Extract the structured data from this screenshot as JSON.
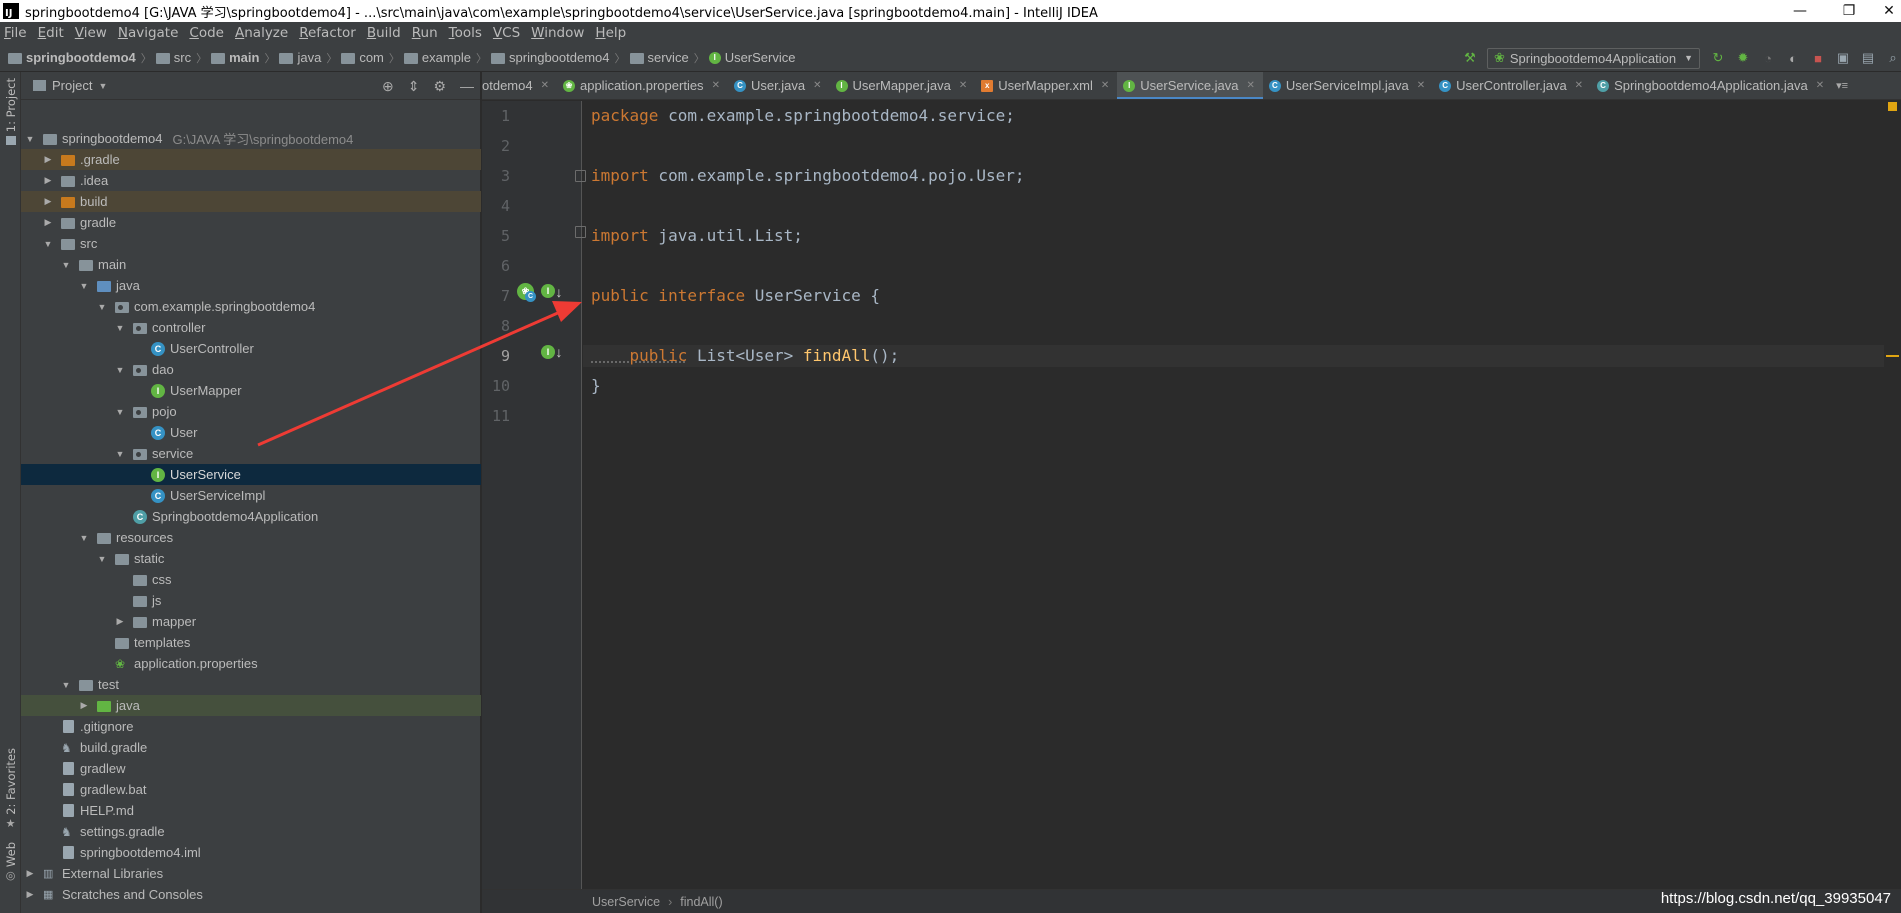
{
  "window": {
    "title": "springbootdemo4 [G:\\JAVA 学习\\springbootdemo4] - ...\\src\\main\\java\\com\\example\\springbootdemo4\\service\\UserService.java [springbootdemo4.main] - IntelliJ IDEA",
    "minimize": "—",
    "restore": "❐",
    "close": "✕"
  },
  "menu": [
    "File",
    "Edit",
    "View",
    "Navigate",
    "Code",
    "Analyze",
    "Refactor",
    "Build",
    "Run",
    "Tools",
    "VCS",
    "Window",
    "Help"
  ],
  "navbar": {
    "crumbs": [
      "springbootdemo4",
      "src",
      "main",
      "java",
      "com",
      "example",
      "springbootdemo4",
      "service",
      "UserService"
    ],
    "run_config": "Springbootdemo4Application"
  },
  "side_tabs": {
    "project": "1: Project",
    "favorites": "2: Favorites",
    "web": "Web"
  },
  "project_panel": {
    "title": "Project",
    "tree": [
      {
        "label": "springbootdemo4",
        "hint": "G:\\JAVA 学习\\springbootdemo4"
      },
      {
        "label": ".gradle"
      },
      {
        "label": ".idea"
      },
      {
        "label": "build"
      },
      {
        "label": "gradle"
      },
      {
        "label": "src"
      },
      {
        "label": "main"
      },
      {
        "label": "java"
      },
      {
        "label": "com.example.springbootdemo4"
      },
      {
        "label": "controller"
      },
      {
        "label": "UserController"
      },
      {
        "label": "dao"
      },
      {
        "label": "UserMapper"
      },
      {
        "label": "pojo"
      },
      {
        "label": "User"
      },
      {
        "label": "service"
      },
      {
        "label": "UserService"
      },
      {
        "label": "UserServiceImpl"
      },
      {
        "label": "Springbootdemo4Application"
      },
      {
        "label": "resources"
      },
      {
        "label": "static"
      },
      {
        "label": "css"
      },
      {
        "label": "js"
      },
      {
        "label": "mapper"
      },
      {
        "label": "templates"
      },
      {
        "label": "application.properties"
      },
      {
        "label": "test"
      },
      {
        "label": "java"
      },
      {
        "label": ".gitignore"
      },
      {
        "label": "build.gradle"
      },
      {
        "label": "gradlew"
      },
      {
        "label": "gradlew.bat"
      },
      {
        "label": "HELP.md"
      },
      {
        "label": "settings.gradle"
      },
      {
        "label": "springbootdemo4.iml"
      },
      {
        "label": "External Libraries"
      },
      {
        "label": "Scratches and Consoles"
      }
    ]
  },
  "tabs": [
    {
      "label": "otdemo4"
    },
    {
      "label": "application.properties"
    },
    {
      "label": "User.java"
    },
    {
      "label": "UserMapper.java"
    },
    {
      "label": "UserMapper.xml"
    },
    {
      "label": "UserService.java",
      "active": true
    },
    {
      "label": "UserServiceImpl.java"
    },
    {
      "label": "UserController.java"
    },
    {
      "label": "Springbootdemo4Application.java"
    }
  ],
  "editor": {
    "line_numbers": [
      "1",
      "2",
      "3",
      "4",
      "5",
      "6",
      "7",
      "8",
      "9",
      "10",
      "11"
    ],
    "code": {
      "l1_kw": "package",
      "l1_rest": " com.example.springbootdemo4.service;",
      "l3_kw": "import",
      "l3_rest": " com.example.springbootdemo4.pojo.User;",
      "l5_kw": "import",
      "l5_rest": " java.util.List;",
      "l7_kw": "public interface",
      "l7_rest": " UserService {",
      "l9_kw": "    public",
      "l9_type": " List<User> ",
      "l9_fn": "findAll",
      "l9_end": "();",
      "l10": "}"
    },
    "breadcrumbs": [
      "UserService",
      "findAll()"
    ]
  },
  "watermark": "https://blog.csdn.net/qq_39935047",
  "colors": {
    "keyword": "#cc7832",
    "method": "#ffc66d",
    "annotation_arrow": "#ee3b34",
    "selection": "#0d293e"
  }
}
